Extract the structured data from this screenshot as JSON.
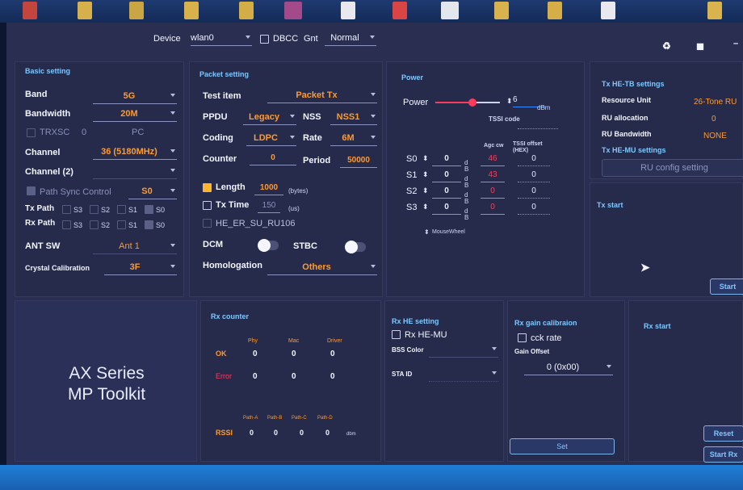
{
  "toolbar": {
    "device_label": "Device",
    "device_value": "wlan0",
    "dbcc_label": "DBCC",
    "gnt_label": "Gnt",
    "gnt_value": "Normal"
  },
  "basic": {
    "title": "Basic setting",
    "band_label": "Band",
    "band_value": "5G",
    "bandwidth_label": "Bandwidth",
    "bandwidth_value": "20M",
    "trxsc_label": "TRXSC",
    "trxsc_value": "0",
    "pc_label": "PC",
    "channel_label": "Channel",
    "channel_value": "36 (5180MHz)",
    "channel2_label": "Channel (2)",
    "path_sync_label": "Path Sync Control",
    "path_sync_value": "S0",
    "tx_path_label": "Tx Path",
    "rx_path_label": "Rx Path",
    "paths": [
      "S3",
      "S2",
      "S1",
      "S0"
    ],
    "ant_sw_label": "ANT SW",
    "ant_sw_value": "Ant 1",
    "crystal_label": "Crystal Calibration",
    "crystal_value": "3F"
  },
  "packet": {
    "title": "Packet setting",
    "test_item_label": "Test item",
    "test_item_value": "Packet Tx",
    "ppdu_label": "PPDU",
    "ppdu_value": "Legacy",
    "nss_label": "NSS",
    "nss_value": "NSS1",
    "coding_label": "Coding",
    "coding_value": "LDPC",
    "rate_label": "Rate",
    "rate_value": "6M",
    "counter_label": "Counter",
    "counter_value": "0",
    "period_label": "Period",
    "period_value": "50000",
    "length_label": "Length",
    "length_value": "1000",
    "length_unit": "(bytes)",
    "txtime_label": "Tx Time",
    "txtime_value": "150",
    "txtime_unit": "(us)",
    "he_er_label": "HE_ER_SU_RU106",
    "dcm_label": "DCM",
    "stbc_label": "STBC",
    "homologation_label": "Homologation",
    "homologation_value": "Others"
  },
  "power": {
    "title": "Power",
    "power_label": "Power",
    "power_value": "6",
    "power_unit": "dBm",
    "tssi_code_label": "TSSI code",
    "agc_label": "Agc cw",
    "tssi_offset_label": "TSSI offset",
    "hex_label": "(HEX)",
    "unit_letters": [
      "d",
      "B"
    ],
    "rows": [
      {
        "name": "S0",
        "value": "0",
        "agc": "46",
        "offset": "0"
      },
      {
        "name": "S1",
        "value": "0",
        "agc": "43",
        "offset": "0"
      },
      {
        "name": "S2",
        "value": "0",
        "agc": "0",
        "offset": "0"
      },
      {
        "name": "S3",
        "value": "0",
        "agc": "0",
        "offset": "0"
      }
    ],
    "mousewheel_label": "MouseWheel",
    "slider_level": 0.55
  },
  "tx_he_tb": {
    "title": "Tx HE-TB settings",
    "resource_unit_label": "Resource Unit",
    "resource_unit_value": "26-Tone RU",
    "ru_allocation_label": "RU allocation",
    "ru_allocation_value": "0",
    "ru_bandwidth_label": "RU Bandwidth",
    "ru_bandwidth_value": "NONE",
    "he_mu_title": "Tx HE-MU settings",
    "ru_config_button": "RU config setting"
  },
  "tx_start": {
    "title": "Tx start",
    "start_button": "Start"
  },
  "brand": {
    "line1": "AX Series",
    "line2": "MP Toolkit"
  },
  "rx_counter": {
    "title": "Rx counter",
    "columns": [
      "Phy",
      "Mac",
      "Driver"
    ],
    "ok_label": "OK",
    "ok_values": [
      "0",
      "0",
      "0"
    ],
    "error_label": "Error",
    "error_values": [
      "0",
      "0",
      "0"
    ],
    "path_columns": [
      "Path-A",
      "Path-B",
      "Path-C",
      "Path-D"
    ],
    "rssi_label": "RSSI",
    "rssi_values": [
      "0",
      "0",
      "0",
      "0"
    ],
    "rssi_unit": "dbm"
  },
  "rx_he": {
    "title": "Rx HE setting",
    "he_mu_label": "Rx HE-MU",
    "bss_color_label": "BSS Color",
    "sta_id_label": "STA ID"
  },
  "rx_gain": {
    "title": "Rx gain calibraion",
    "cck_label": "cck rate",
    "gain_offset_label": "Gain Offset",
    "gain_offset_value": "0 (0x00)",
    "set_button": "Set"
  },
  "rx_start": {
    "title": "Rx start",
    "reset_button": "Reset",
    "start_rx_button": "Start Rx"
  },
  "colors": {
    "accent": "#ff9a2e",
    "error": "#ff3b5c",
    "title": "#7fc7ff",
    "bg": "#2a2f52"
  }
}
